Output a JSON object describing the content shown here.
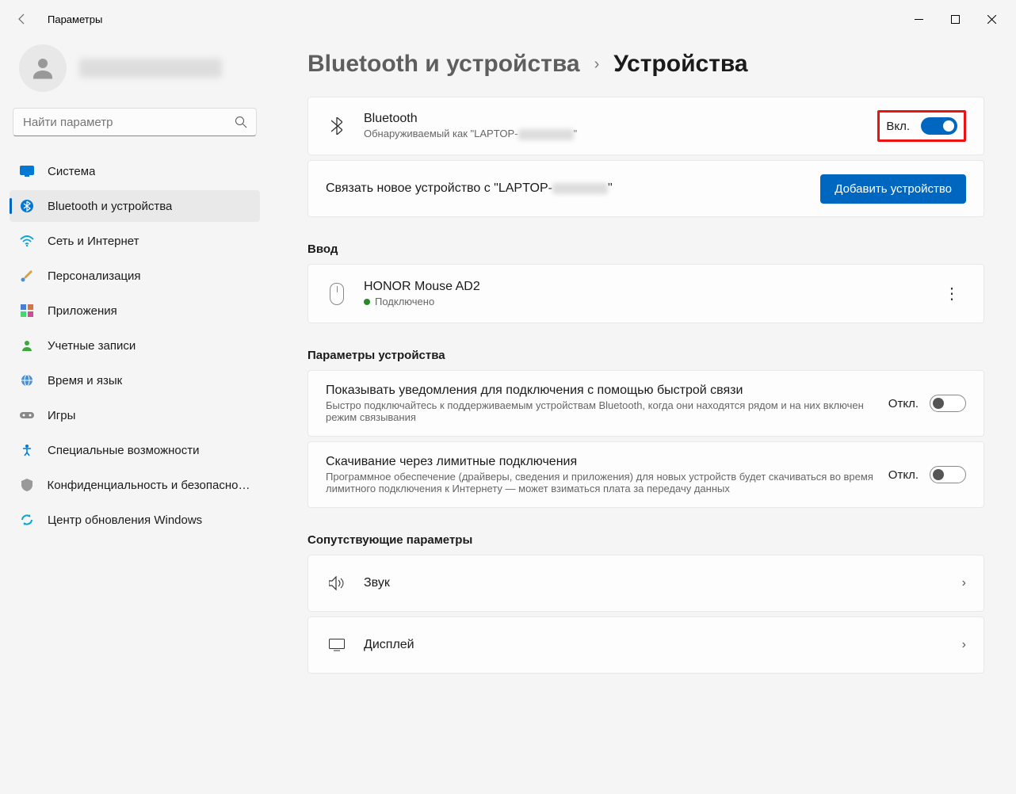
{
  "window": {
    "title": "Параметры"
  },
  "search": {
    "placeholder": "Найти параметр"
  },
  "nav": {
    "items": [
      {
        "label": "Система"
      },
      {
        "label": "Bluetooth и устройства"
      },
      {
        "label": "Сеть и Интернет"
      },
      {
        "label": "Персонализация"
      },
      {
        "label": "Приложения"
      },
      {
        "label": "Учетные записи"
      },
      {
        "label": "Время и язык"
      },
      {
        "label": "Игры"
      },
      {
        "label": "Специальные возможности"
      },
      {
        "label": "Конфиденциальность и безопасность"
      },
      {
        "label": "Центр обновления Windows"
      }
    ]
  },
  "breadcrumb": {
    "parent": "Bluetooth и устройства",
    "current": "Устройства"
  },
  "bluetooth": {
    "title": "Bluetooth",
    "discoverable_prefix": "Обнаруживаемый как \"LAPTOP-",
    "toggle_state": "Вкл."
  },
  "pairing": {
    "text_prefix": "Связать новое устройство с \"LAPTOP-",
    "button": "Добавить устройство"
  },
  "sections": {
    "input": "Ввод",
    "device_params": "Параметры устройства",
    "related": "Сопутствующие параметры"
  },
  "input_device": {
    "name": "HONOR Mouse AD2",
    "status": "Подключено"
  },
  "settings": [
    {
      "title": "Показывать уведомления для подключения с помощью быстрой связи",
      "desc": "Быстро подключайтесь к поддерживаемым устройствам Bluetooth, когда они находятся рядом и на них включен режим связывания",
      "state": "Откл."
    },
    {
      "title": "Скачивание через лимитные подключения",
      "desc": "Программное обеспечение (драйверы, сведения и приложения) для новых устройств будет скачиваться во время лимитного подключения к Интернету — может взиматься плата за передачу данных",
      "state": "Откл."
    }
  ],
  "related": [
    {
      "label": "Звук"
    },
    {
      "label": "Дисплей"
    }
  ]
}
